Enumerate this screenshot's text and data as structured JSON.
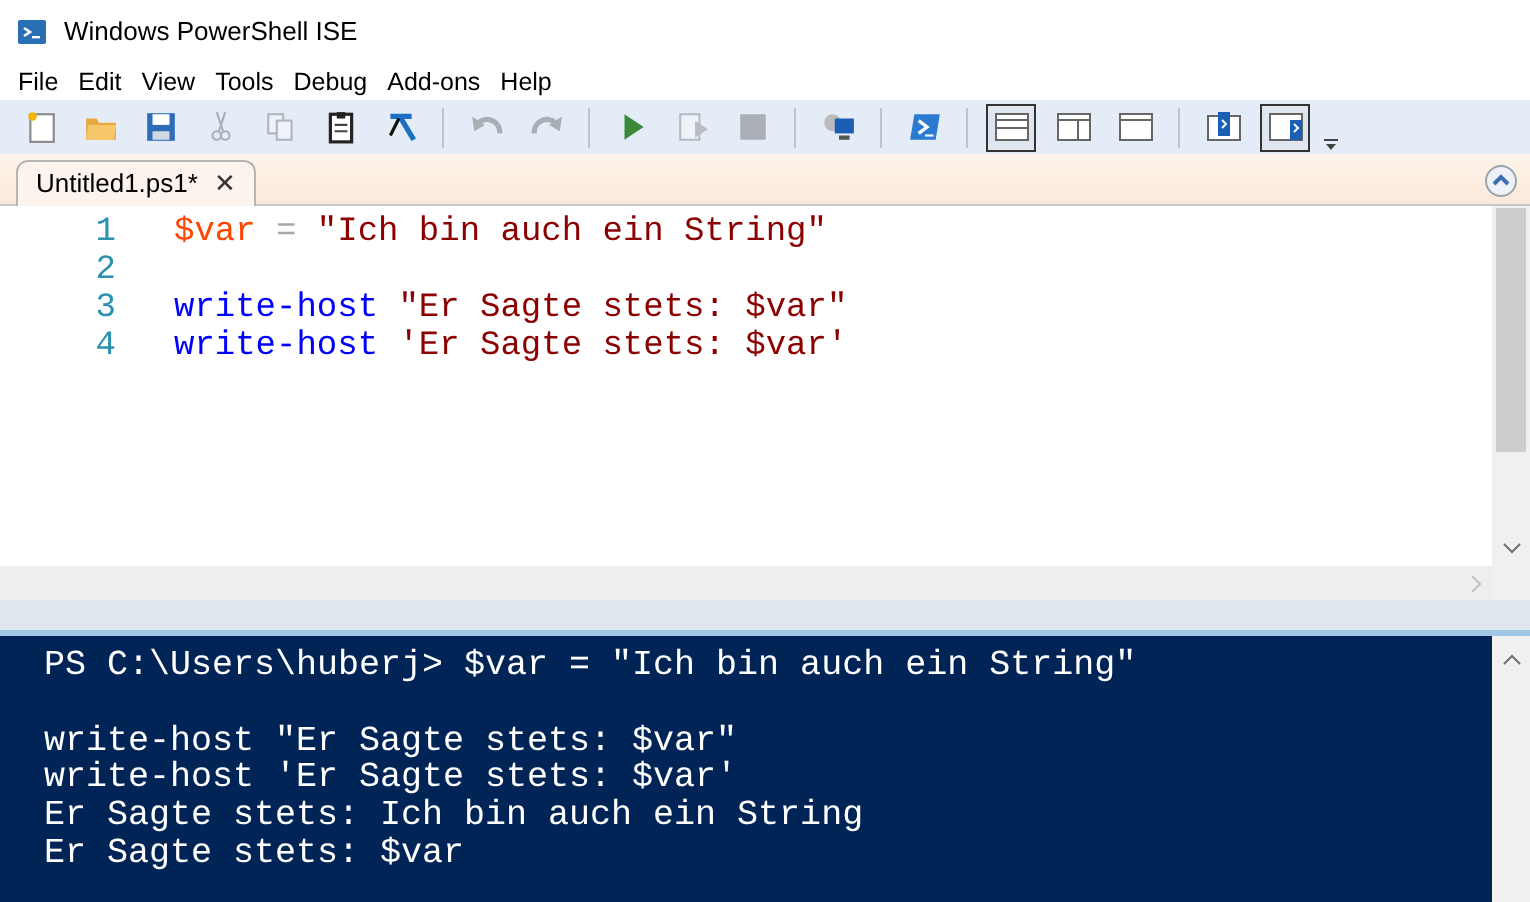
{
  "window": {
    "title": "Windows PowerShell ISE"
  },
  "menu": [
    "File",
    "Edit",
    "View",
    "Tools",
    "Debug",
    "Add-ons",
    "Help"
  ],
  "toolbar": [
    {
      "disabled": false
    },
    {
      "disabled": false
    },
    {
      "disabled": false
    },
    {
      "disabled": true
    },
    {
      "disabled": true
    },
    {
      "disabled": false
    },
    {
      "disabled": false
    },
    {
      "disabled": true
    },
    {
      "disabled": true
    },
    {
      "disabled": false
    },
    {
      "disabled": true
    },
    {
      "disabled": true
    },
    {
      "disabled": false
    },
    {
      "disabled": false
    }
  ],
  "view_buttons": [
    {
      "selected": true
    },
    {
      "selected": false
    },
    {
      "selected": false
    },
    {
      "selected": false
    },
    {
      "selected": true
    }
  ],
  "tabs": [
    {
      "label": "Untitled1.ps1*",
      "close": "✕",
      "selected": true
    }
  ],
  "editor": {
    "lines": [
      {
        "number": "1",
        "tokens": [
          {
            "kind": "variable",
            "text": "$var"
          },
          {
            "kind": "operator",
            "text": " = "
          },
          {
            "kind": "string",
            "text": "\"Ich bin auch ein String\""
          }
        ]
      },
      {
        "number": "2"
      },
      {
        "number": "3",
        "tokens": [
          {
            "kind": "command",
            "text": "write-host"
          },
          {
            "kind": "string",
            "text": "\"Er Sagte stets: $var\""
          }
        ]
      },
      {
        "number": "4",
        "tokens": [
          {
            "kind": "command",
            "text": "write-host"
          },
          {
            "kind": "string",
            "text": "'Er Sagte stets: $var'"
          }
        ]
      }
    ]
  },
  "console": {
    "blocks": [
      [
        "PS C:\\Users\\huberj> $var = \"Ich bin auch ein String\""
      ],
      [
        "write-host \"Er Sagte stets: $var\"",
        "write-host 'Er Sagte stets: $var'",
        "Er Sagte stets: Ich bin auch ein String",
        "Er Sagte stets: $var"
      ]
    ]
  }
}
